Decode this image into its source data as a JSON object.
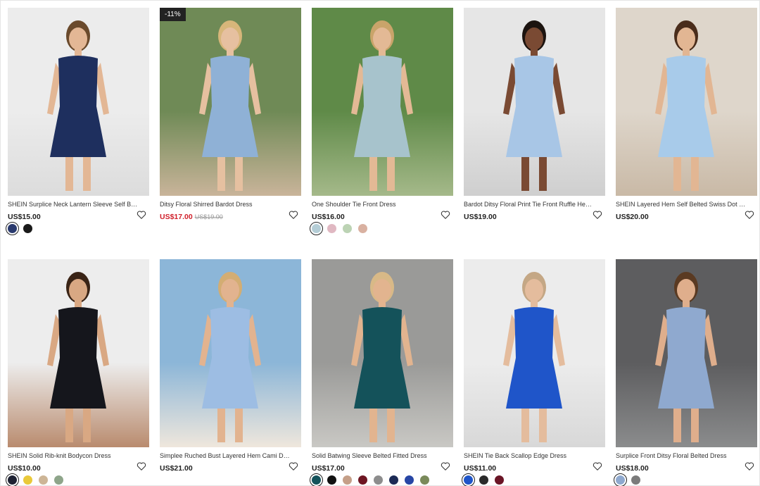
{
  "colors": {
    "text": "#222222",
    "sale_price": "#d0202b",
    "badge_bg": "#222222"
  },
  "products": [
    {
      "title": "SHEIN Surplice Neck Lantern Sleeve Self Belted ...",
      "price": "US$15.00",
      "badge": "",
      "old_price": "",
      "on_sale": false,
      "bg": [
        "#ececec",
        "#dcdcdc"
      ],
      "dress": "#1e2f5e",
      "skin": "#e3b795",
      "hair": "#6a4a2c",
      "swatches": [
        "#2a3a6e",
        "#1a1a1a"
      ]
    },
    {
      "title": "Ditsy Floral Shirred Bardot Dress",
      "price": "US$17.00",
      "badge": "-11%",
      "old_price": "US$19.00",
      "on_sale": true,
      "bg": [
        "#6f8a56",
        "#c9b49a"
      ],
      "dress": "#8fb1d6",
      "skin": "#e6c0a0",
      "hair": "#d7b67a",
      "swatches": []
    },
    {
      "title": "One Shoulder Tie Front Dress",
      "price": "US$16.00",
      "badge": "",
      "old_price": "",
      "on_sale": false,
      "bg": [
        "#5f8a48",
        "#a5b98a"
      ],
      "dress": "#a7c3cc",
      "skin": "#e3b995",
      "hair": "#c9a46a",
      "swatches": [
        "#b4cdd6",
        "#e0b8c2",
        "#bcd3b4",
        "#d9b1a1"
      ]
    },
    {
      "title": "Bardot Ditsy Floral Print Tie Front Ruffle Hem Dress",
      "price": "US$19.00",
      "badge": "",
      "old_price": "",
      "on_sale": false,
      "bg": [
        "#e6e6e6",
        "#cfcfcf"
      ],
      "dress": "#a8c6e6",
      "skin": "#7a4a33",
      "hair": "#1c1410",
      "swatches": []
    },
    {
      "title": "SHEIN Layered Hem Self Belted Swiss Dot Cami...",
      "price": "US$20.00",
      "badge": "",
      "old_price": "",
      "on_sale": false,
      "bg": [
        "#ded6cb",
        "#c9b9a6"
      ],
      "dress": "#a8cbea",
      "skin": "#e2b693",
      "hair": "#4a2d1b",
      "swatches": []
    },
    {
      "title": "SHEIN Solid Rib-knit Bodycon Dress",
      "price": "US$10.00",
      "badge": "",
      "old_price": "",
      "on_sale": false,
      "bg": [
        "#ededed",
        "#b98b6e"
      ],
      "dress": "#15161c",
      "skin": "#d9a883",
      "hair": "#3a2416",
      "swatches": [
        "#1e2233",
        "#e9c93a",
        "#cdb596",
        "#8ea58a"
      ]
    },
    {
      "title": "Simplee Ruched Bust Layered Hem Cami Dress",
      "price": "US$21.00",
      "badge": "",
      "old_price": "",
      "on_sale": false,
      "bg": [
        "#8cb6d8",
        "#efe7dc"
      ],
      "dress": "#9dbde3",
      "skin": "#e2b38f",
      "hair": "#d3ad73",
      "swatches": []
    },
    {
      "title": "Solid Batwing Sleeve Belted Fitted Dress",
      "price": "US$17.00",
      "badge": "",
      "old_price": "",
      "on_sale": false,
      "bg": [
        "#9a9a98",
        "#c9c8c4"
      ],
      "dress": "#14525a",
      "skin": "#e2b48f",
      "hair": "#d8b987",
      "swatches": [
        "#14525a",
        "#111111",
        "#c59f88",
        "#6e1622",
        "#8d8d8d",
        "#1c2a55",
        "#2746a5",
        "#7a8a5a"
      ]
    },
    {
      "title": "SHEIN Tie Back Scallop Edge Dress",
      "price": "US$11.00",
      "badge": "",
      "old_price": "",
      "on_sale": false,
      "bg": [
        "#ececec",
        "#d8d8d8"
      ],
      "dress": "#1f55c9",
      "skin": "#e4bc9d",
      "hair": "#c4a785",
      "swatches": [
        "#1f55c9",
        "#2a2a2a",
        "#6a1526"
      ]
    },
    {
      "title": "Surplice Front Ditsy Floral Belted Dress",
      "price": "US$18.00",
      "badge": "",
      "old_price": "",
      "on_sale": false,
      "bg": [
        "#5d5d5f",
        "#8b8c8d"
      ],
      "dress": "#8fa9cf",
      "skin": "#dfae8c",
      "hair": "#5a3a22",
      "swatches": [
        "#8fa9cf",
        "#7b7b7b"
      ]
    }
  ]
}
